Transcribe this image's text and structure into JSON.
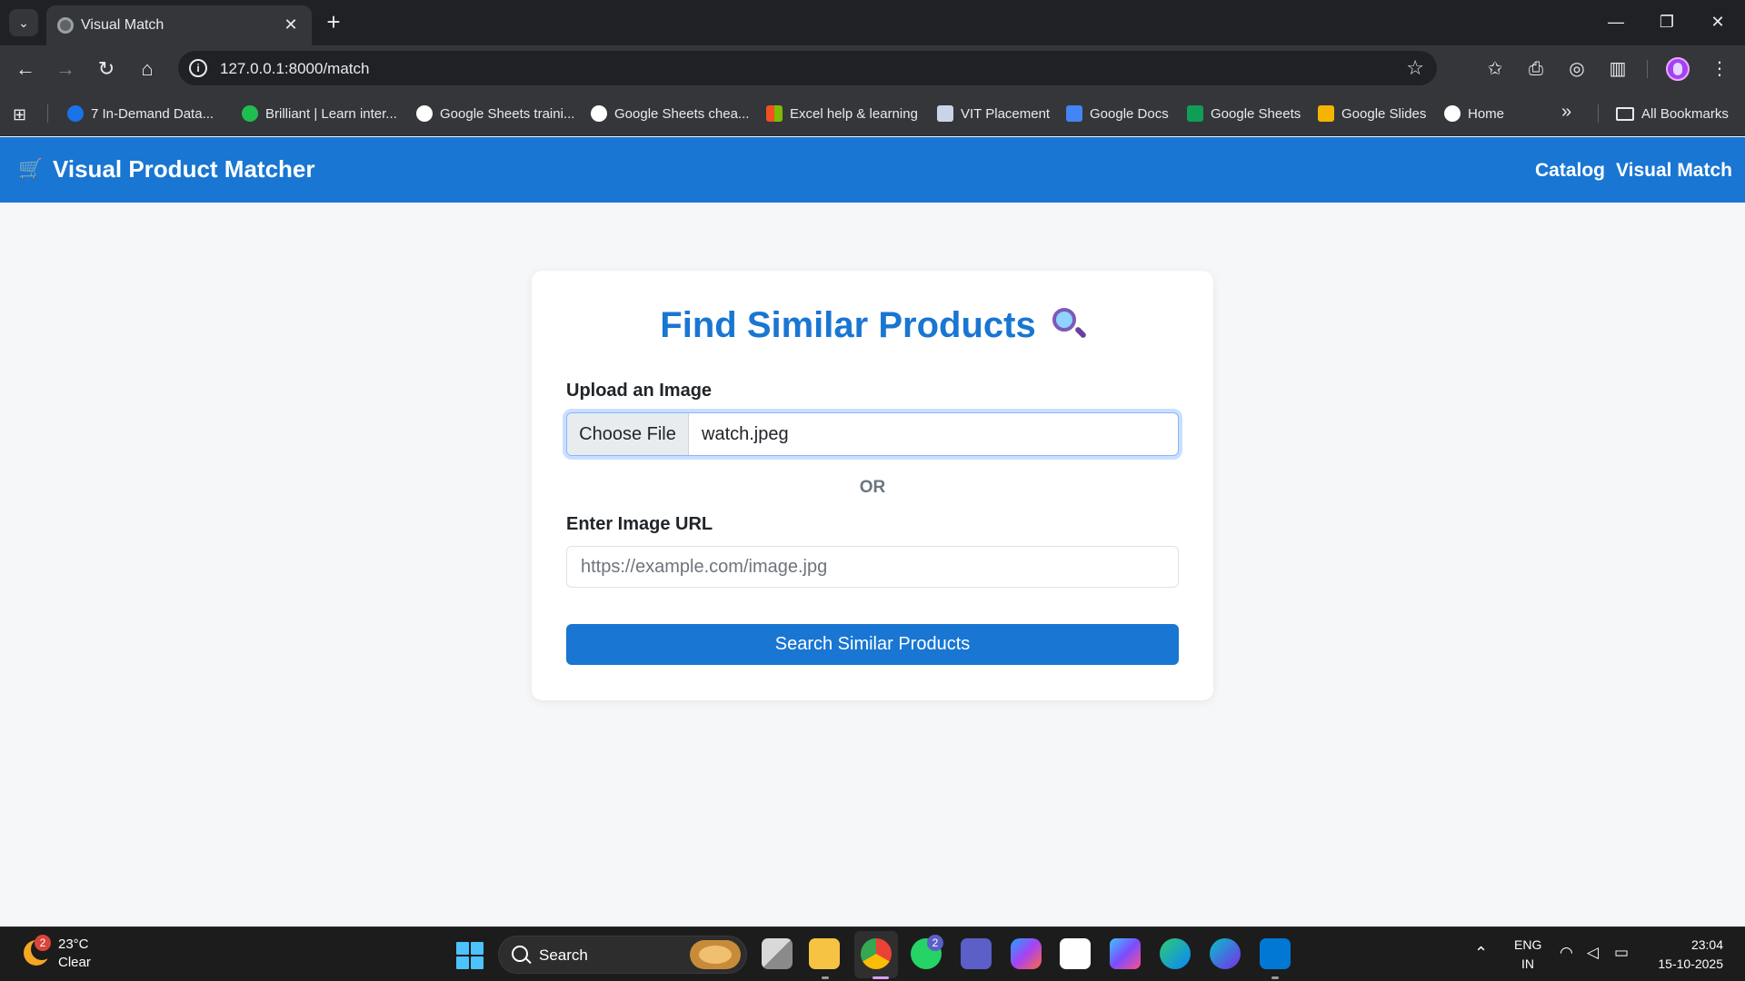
{
  "browser": {
    "tab": {
      "title": "Visual Match",
      "close_glyph": "✕"
    },
    "new_tab_glyph": "+",
    "address": {
      "url": "127.0.0.1:8000/match"
    },
    "window_controls": {
      "minimize": "—",
      "restore": "❐",
      "close": "✕"
    },
    "bookmarks": [
      {
        "label": "7 In-Demand Data...",
        "icon": "coursera-icon",
        "color": "#1a73e8"
      },
      {
        "label": "Brilliant | Learn inter...",
        "icon": "brilliant-icon",
        "color": "#1fbf4f"
      },
      {
        "label": "Google Sheets traini...",
        "icon": "google-icon",
        "color": "#ffffff"
      },
      {
        "label": "Google Sheets chea...",
        "icon": "google-icon",
        "color": "#ffffff"
      },
      {
        "label": "Excel help & learning",
        "icon": "microsoft-icon",
        "color": "#f25022"
      },
      {
        "label": "VIT Placement",
        "icon": "vit-icon",
        "color": "#c9d4ea"
      },
      {
        "label": "Google Docs",
        "icon": "docs-icon",
        "color": "#4285f4"
      },
      {
        "label": "Google Sheets",
        "icon": "sheets-icon",
        "color": "#0f9d58"
      },
      {
        "label": "Google Slides",
        "icon": "slides-icon",
        "color": "#f4b400"
      },
      {
        "label": "Home",
        "icon": "google-icon",
        "color": "#ffffff"
      }
    ],
    "more_bookmarks_glyph": "»",
    "all_bookmarks_label": "All Bookmarks"
  },
  "app": {
    "brand": {
      "icon": "cart-icon",
      "title": "Visual Product Matcher"
    },
    "nav": {
      "catalog": "Catalog",
      "visual_match": "Visual Match"
    },
    "card": {
      "title": "Find Similar Products",
      "upload_label": "Upload an Image",
      "choose_file_label": "Choose File",
      "file_name": "watch.jpeg",
      "or_text": "OR",
      "url_label": "Enter Image URL",
      "url_placeholder": "https://example.com/image.jpg",
      "url_value": "",
      "submit_label": "Search Similar Products"
    },
    "colors": {
      "primary": "#1976d2",
      "background": "#f6f7f9"
    }
  },
  "taskbar": {
    "weather": {
      "temp": "23°C",
      "condition": "Clear",
      "badge": "2"
    },
    "search_label": "Search",
    "whatsapp_badge": "2",
    "lang": {
      "line1": "ENG",
      "line2": "IN"
    },
    "clock": {
      "time": "23:04",
      "date": "15-10-2025"
    }
  }
}
